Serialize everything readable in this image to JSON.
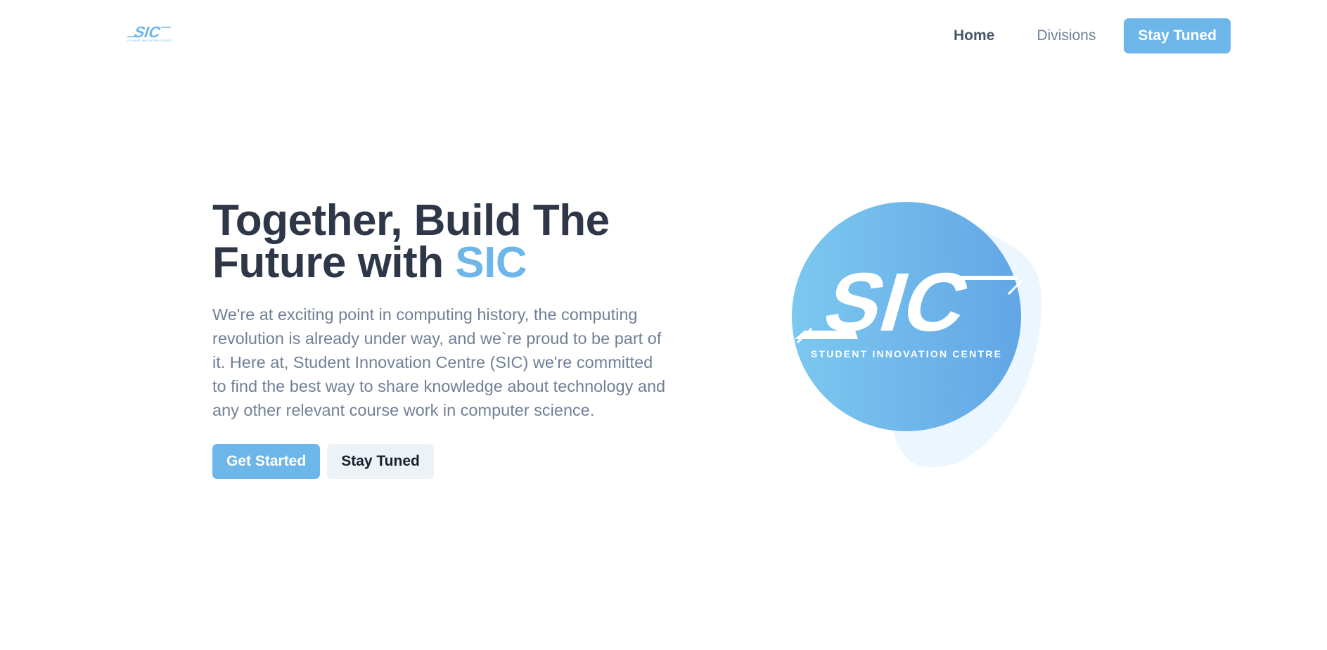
{
  "nav": {
    "logo": {
      "text": "SIC",
      "subtext": "STUDENT INNOVATION CENTRE",
      "color": "#6cb6e9"
    },
    "links": [
      {
        "label": "Home",
        "active": true
      },
      {
        "label": "Divisions",
        "active": false
      }
    ],
    "cta_label": "Stay Tuned"
  },
  "hero": {
    "title_line1": "Together, Build The",
    "title_line2_prefix": "Future with ",
    "title_accent": "SIC",
    "description": "We're at exciting point in computing history, the computing revolution is already under way, and we`re proud to be part of it. Here at, Student Innovation Centre (SIC) we're committed to find the best way to share knowledge about technology and any other relevant course work in computer science.",
    "primary_button": "Get Started",
    "secondary_button": "Stay Tuned",
    "emblem": {
      "text": "SIC",
      "subtext": "STUDENT INNOVATION CENTRE"
    }
  },
  "colors": {
    "accent": "#6cb6e9",
    "heading": "#2d3748",
    "body_text": "#718096",
    "blob": "#ebf6fe",
    "secondary_button_bg": "#edf2f7"
  }
}
